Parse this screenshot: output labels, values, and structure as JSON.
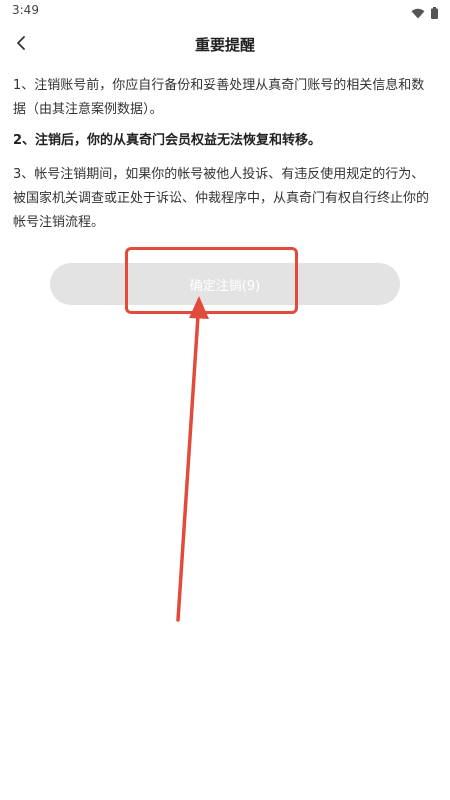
{
  "status_bar": {
    "time": "3:49",
    "icons": [
      "wifi-icon",
      "battery-icon"
    ]
  },
  "header": {
    "back_icon": "chevron-left-icon",
    "title": "重要提醒"
  },
  "notices": [
    "1、注销账号前，你应自行备份和妥善处理从真奇门账号的相关信息和数据（由其注意案例数据）。",
    "2、注销后，你的从真奇门会员权益无法恢复和转移。",
    "3、帐号注销期间，如果你的帐号被他人投诉、有违反使用规定的行为、被国家机关调查或正处于诉讼、仲裁程序中，从真奇门有权自行终止你的帐号注销流程。"
  ],
  "confirm_button": {
    "label": "确定注销(9)",
    "disabled": true
  },
  "colors": {
    "annotation": "#e24b3b",
    "button_disabled_bg": "#e3e3e3"
  }
}
